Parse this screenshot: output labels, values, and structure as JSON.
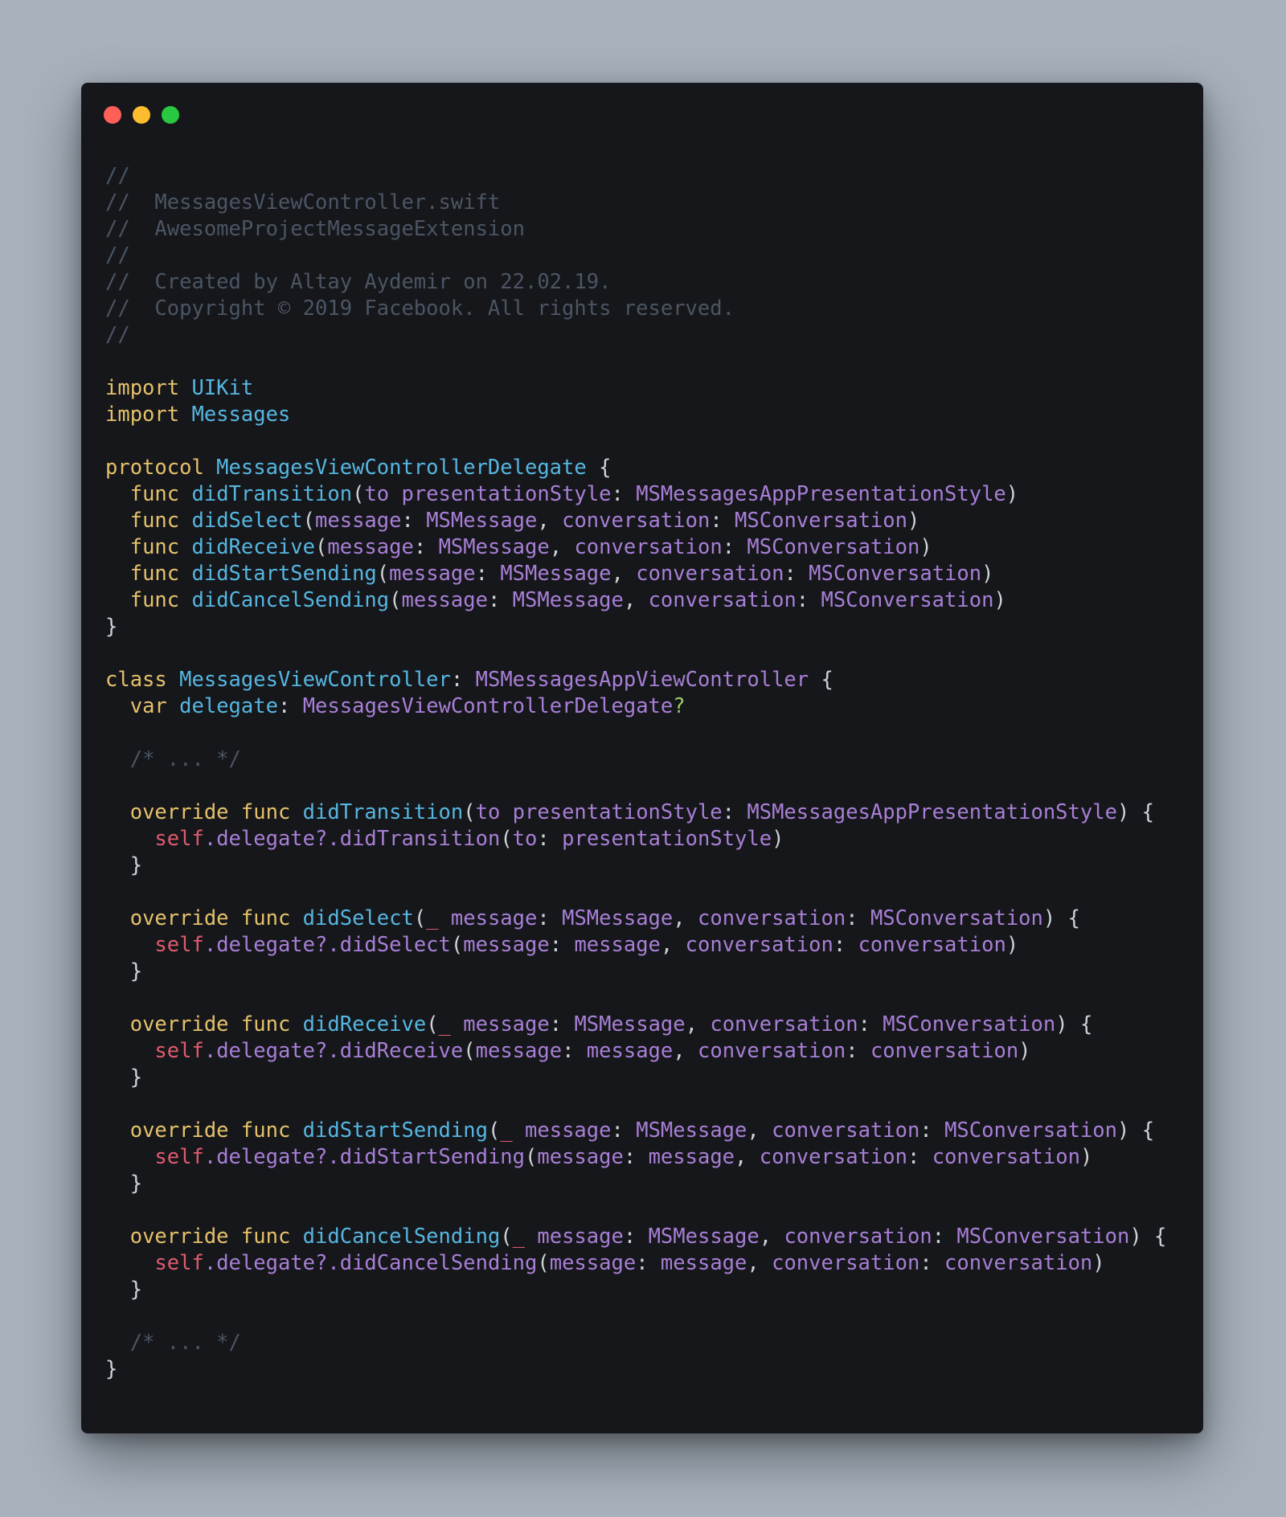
{
  "window": {
    "controls": [
      {
        "name": "close-button",
        "color": "#fe5f57"
      },
      {
        "name": "minimize-button",
        "color": "#febc2e"
      },
      {
        "name": "zoom-button",
        "color": "#28c840"
      }
    ]
  },
  "colors": {
    "comment": "#4b5563",
    "keyword": "#e5c16a",
    "type": "#56b6e0",
    "method": "#56b6e0",
    "param": "#a87fd6",
    "identifier": "#a87fd6",
    "self": "#e05a6e",
    "plain": "#cfd3d8",
    "underscore": "#e05a6e",
    "optional": "#9ccc65",
    "background": "#16171b",
    "page": "#a7b2bd"
  },
  "code": {
    "lines": [
      [
        [
          "comment",
          "//"
        ]
      ],
      [
        [
          "comment",
          "//  MessagesViewController.swift"
        ]
      ],
      [
        [
          "comment",
          "//  AwesomeProjectMessageExtension"
        ]
      ],
      [
        [
          "comment",
          "//"
        ]
      ],
      [
        [
          "comment",
          "//  Created by Altay Aydemir on 22.02.19."
        ]
      ],
      [
        [
          "comment",
          "//  Copyright © 2019 Facebook. All rights reserved."
        ]
      ],
      [
        [
          "comment",
          "//"
        ]
      ],
      [],
      [
        [
          "keyword",
          "import "
        ],
        [
          "type",
          "UIKit"
        ]
      ],
      [
        [
          "keyword",
          "import "
        ],
        [
          "type",
          "Messages"
        ]
      ],
      [],
      [
        [
          "keyword",
          "protocol "
        ],
        [
          "type",
          "MessagesViewControllerDelegate"
        ],
        [
          "plain",
          " {"
        ]
      ],
      [
        [
          "plain",
          "  "
        ],
        [
          "keyword",
          "func "
        ],
        [
          "method",
          "didTransition"
        ],
        [
          "plain",
          "("
        ],
        [
          "param",
          "to presentationStyle"
        ],
        [
          "plain",
          ": "
        ],
        [
          "identifier",
          "MSMessagesAppPresentationStyle"
        ],
        [
          "plain",
          ")"
        ]
      ],
      [
        [
          "plain",
          "  "
        ],
        [
          "keyword",
          "func "
        ],
        [
          "method",
          "didSelect"
        ],
        [
          "plain",
          "("
        ],
        [
          "param",
          "message"
        ],
        [
          "plain",
          ": "
        ],
        [
          "identifier",
          "MSMessage"
        ],
        [
          "plain",
          ", "
        ],
        [
          "param",
          "conversation"
        ],
        [
          "plain",
          ": "
        ],
        [
          "identifier",
          "MSConversation"
        ],
        [
          "plain",
          ")"
        ]
      ],
      [
        [
          "plain",
          "  "
        ],
        [
          "keyword",
          "func "
        ],
        [
          "method",
          "didReceive"
        ],
        [
          "plain",
          "("
        ],
        [
          "param",
          "message"
        ],
        [
          "plain",
          ": "
        ],
        [
          "identifier",
          "MSMessage"
        ],
        [
          "plain",
          ", "
        ],
        [
          "param",
          "conversation"
        ],
        [
          "plain",
          ": "
        ],
        [
          "identifier",
          "MSConversation"
        ],
        [
          "plain",
          ")"
        ]
      ],
      [
        [
          "plain",
          "  "
        ],
        [
          "keyword",
          "func "
        ],
        [
          "method",
          "didStartSending"
        ],
        [
          "plain",
          "("
        ],
        [
          "param",
          "message"
        ],
        [
          "plain",
          ": "
        ],
        [
          "identifier",
          "MSMessage"
        ],
        [
          "plain",
          ", "
        ],
        [
          "param",
          "conversation"
        ],
        [
          "plain",
          ": "
        ],
        [
          "identifier",
          "MSConversation"
        ],
        [
          "plain",
          ")"
        ]
      ],
      [
        [
          "plain",
          "  "
        ],
        [
          "keyword",
          "func "
        ],
        [
          "method",
          "didCancelSending"
        ],
        [
          "plain",
          "("
        ],
        [
          "param",
          "message"
        ],
        [
          "plain",
          ": "
        ],
        [
          "identifier",
          "MSMessage"
        ],
        [
          "plain",
          ", "
        ],
        [
          "param",
          "conversation"
        ],
        [
          "plain",
          ": "
        ],
        [
          "identifier",
          "MSConversation"
        ],
        [
          "plain",
          ")"
        ]
      ],
      [
        [
          "plain",
          "}"
        ]
      ],
      [],
      [
        [
          "keyword",
          "class "
        ],
        [
          "type",
          "MessagesViewController"
        ],
        [
          "plain",
          ": "
        ],
        [
          "identifier",
          "MSMessagesAppViewController"
        ],
        [
          "plain",
          " {"
        ]
      ],
      [
        [
          "plain",
          "  "
        ],
        [
          "keyword",
          "var "
        ],
        [
          "type",
          "delegate"
        ],
        [
          "plain",
          ": "
        ],
        [
          "identifier",
          "MessagesViewControllerDelegate"
        ],
        [
          "optional",
          "?"
        ]
      ],
      [],
      [
        [
          "plain",
          "  "
        ],
        [
          "comment",
          "/* ... */"
        ]
      ],
      [],
      [
        [
          "plain",
          "  "
        ],
        [
          "keyword",
          "override func "
        ],
        [
          "method",
          "didTransition"
        ],
        [
          "plain",
          "("
        ],
        [
          "param",
          "to presentationStyle"
        ],
        [
          "plain",
          ": "
        ],
        [
          "identifier",
          "MSMessagesAppPresentationStyle"
        ],
        [
          "plain",
          ") {"
        ]
      ],
      [
        [
          "plain",
          "    "
        ],
        [
          "self",
          "self"
        ],
        [
          "identifier",
          ".delegate?.didTransition"
        ],
        [
          "plain",
          "("
        ],
        [
          "param",
          "to"
        ],
        [
          "plain",
          ": "
        ],
        [
          "identifier",
          "presentationStyle"
        ],
        [
          "plain",
          ")"
        ]
      ],
      [
        [
          "plain",
          "  }"
        ]
      ],
      [],
      [
        [
          "plain",
          "  "
        ],
        [
          "keyword",
          "override func "
        ],
        [
          "method",
          "didSelect"
        ],
        [
          "plain",
          "("
        ],
        [
          "underscore",
          "_"
        ],
        [
          "param",
          " message"
        ],
        [
          "plain",
          ": "
        ],
        [
          "identifier",
          "MSMessage"
        ],
        [
          "plain",
          ", "
        ],
        [
          "param",
          "conversation"
        ],
        [
          "plain",
          ": "
        ],
        [
          "identifier",
          "MSConversation"
        ],
        [
          "plain",
          ") {"
        ]
      ],
      [
        [
          "plain",
          "    "
        ],
        [
          "self",
          "self"
        ],
        [
          "identifier",
          ".delegate?.didSelect"
        ],
        [
          "plain",
          "("
        ],
        [
          "param",
          "message"
        ],
        [
          "plain",
          ": "
        ],
        [
          "identifier",
          "message"
        ],
        [
          "plain",
          ", "
        ],
        [
          "param",
          "conversation"
        ],
        [
          "plain",
          ": "
        ],
        [
          "identifier",
          "conversation"
        ],
        [
          "plain",
          ")"
        ]
      ],
      [
        [
          "plain",
          "  }"
        ]
      ],
      [],
      [
        [
          "plain",
          "  "
        ],
        [
          "keyword",
          "override func "
        ],
        [
          "method",
          "didReceive"
        ],
        [
          "plain",
          "("
        ],
        [
          "underscore",
          "_"
        ],
        [
          "param",
          " message"
        ],
        [
          "plain",
          ": "
        ],
        [
          "identifier",
          "MSMessage"
        ],
        [
          "plain",
          ", "
        ],
        [
          "param",
          "conversation"
        ],
        [
          "plain",
          ": "
        ],
        [
          "identifier",
          "MSConversation"
        ],
        [
          "plain",
          ") {"
        ]
      ],
      [
        [
          "plain",
          "    "
        ],
        [
          "self",
          "self"
        ],
        [
          "identifier",
          ".delegate?.didReceive"
        ],
        [
          "plain",
          "("
        ],
        [
          "param",
          "message"
        ],
        [
          "plain",
          ": "
        ],
        [
          "identifier",
          "message"
        ],
        [
          "plain",
          ", "
        ],
        [
          "param",
          "conversation"
        ],
        [
          "plain",
          ": "
        ],
        [
          "identifier",
          "conversation"
        ],
        [
          "plain",
          ")"
        ]
      ],
      [
        [
          "plain",
          "  }"
        ]
      ],
      [],
      [
        [
          "plain",
          "  "
        ],
        [
          "keyword",
          "override func "
        ],
        [
          "method",
          "didStartSending"
        ],
        [
          "plain",
          "("
        ],
        [
          "underscore",
          "_"
        ],
        [
          "param",
          " message"
        ],
        [
          "plain",
          ": "
        ],
        [
          "identifier",
          "MSMessage"
        ],
        [
          "plain",
          ", "
        ],
        [
          "param",
          "conversation"
        ],
        [
          "plain",
          ": "
        ],
        [
          "identifier",
          "MSConversation"
        ],
        [
          "plain",
          ") {"
        ]
      ],
      [
        [
          "plain",
          "    "
        ],
        [
          "self",
          "self"
        ],
        [
          "identifier",
          ".delegate?.didStartSending"
        ],
        [
          "plain",
          "("
        ],
        [
          "param",
          "message"
        ],
        [
          "plain",
          ": "
        ],
        [
          "identifier",
          "message"
        ],
        [
          "plain",
          ", "
        ],
        [
          "param",
          "conversation"
        ],
        [
          "plain",
          ": "
        ],
        [
          "identifier",
          "conversation"
        ],
        [
          "plain",
          ")"
        ]
      ],
      [
        [
          "plain",
          "  }"
        ]
      ],
      [],
      [
        [
          "plain",
          "  "
        ],
        [
          "keyword",
          "override func "
        ],
        [
          "method",
          "didCancelSending"
        ],
        [
          "plain",
          "("
        ],
        [
          "underscore",
          "_"
        ],
        [
          "param",
          " message"
        ],
        [
          "plain",
          ": "
        ],
        [
          "identifier",
          "MSMessage"
        ],
        [
          "plain",
          ", "
        ],
        [
          "param",
          "conversation"
        ],
        [
          "plain",
          ": "
        ],
        [
          "identifier",
          "MSConversation"
        ],
        [
          "plain",
          ") {"
        ]
      ],
      [
        [
          "plain",
          "    "
        ],
        [
          "self",
          "self"
        ],
        [
          "identifier",
          ".delegate?.didCancelSending"
        ],
        [
          "plain",
          "("
        ],
        [
          "param",
          "message"
        ],
        [
          "plain",
          ": "
        ],
        [
          "identifier",
          "message"
        ],
        [
          "plain",
          ", "
        ],
        [
          "param",
          "conversation"
        ],
        [
          "plain",
          ": "
        ],
        [
          "identifier",
          "conversation"
        ],
        [
          "plain",
          ")"
        ]
      ],
      [
        [
          "plain",
          "  }"
        ]
      ],
      [],
      [
        [
          "plain",
          "  "
        ],
        [
          "comment",
          "/* ... */"
        ]
      ],
      [
        [
          "plain",
          "}"
        ]
      ]
    ]
  }
}
